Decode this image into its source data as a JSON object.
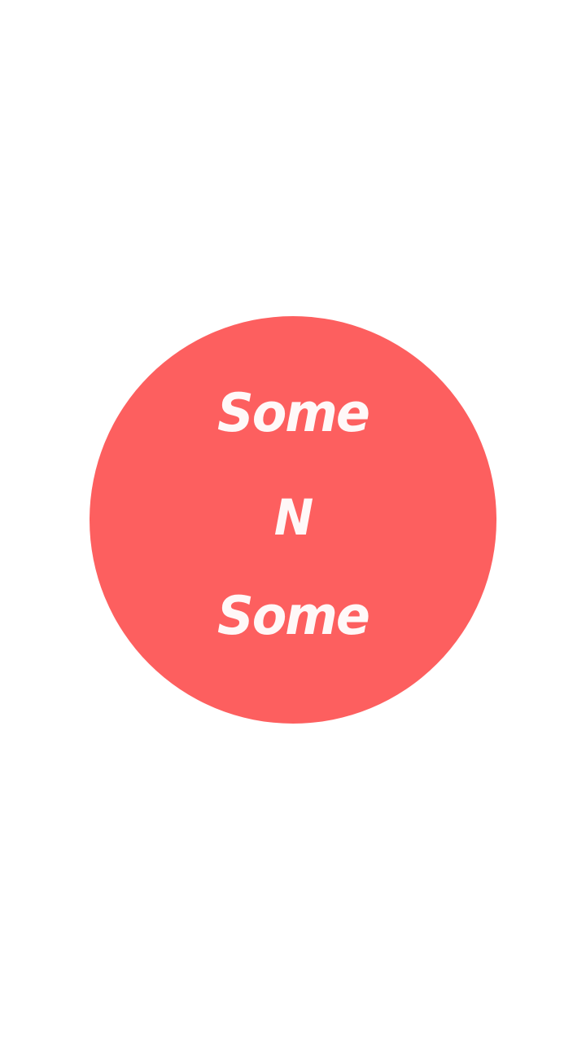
{
  "splash": {
    "logo": {
      "line1": "Some",
      "line2": "N",
      "line3": "Some",
      "background_color": "#fd5f5f",
      "text_color": "#fff8f8"
    }
  }
}
